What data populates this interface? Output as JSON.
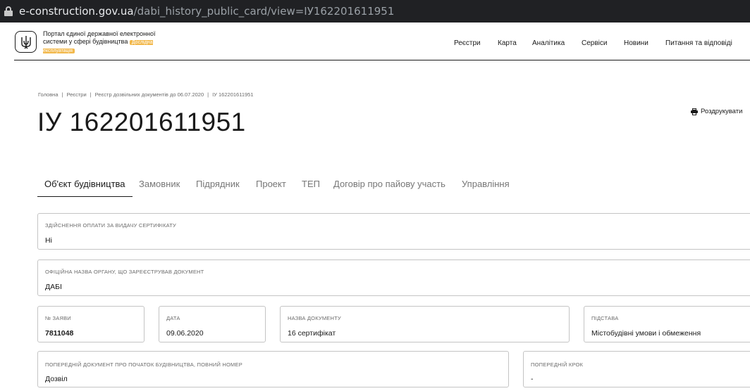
{
  "browser": {
    "url_domain": "e-construction.gov.ua",
    "url_path": "/dabi_history_public_card/view=ІУ162201611951"
  },
  "header": {
    "portal_name": "Портал єдиної державної електронної системи у сфері будівництва",
    "badge": "Дослідна експлуатація",
    "nav": [
      "Реєстри",
      "Карта",
      "Аналітика",
      "Сервіси",
      "Новини",
      "Питання та відповіді"
    ]
  },
  "breadcrumb": [
    "Головна",
    "Реєстри",
    "Реєстр дозвільних документів до 06.07.2020",
    "ІУ 162201611951"
  ],
  "title": "ІУ 162201611951",
  "print_label": "Роздрукувати",
  "tabs": [
    "Об'єкт будівництва",
    "Замовник",
    "Підрядник",
    "Проект",
    "ТЕП",
    "Договір про пайову участь",
    "Управління"
  ],
  "fields": {
    "payment": {
      "label": "Здійснення оплати за видачу сертифікату",
      "value": "Ні"
    },
    "authority": {
      "label": "Офіційна назва органу, що зареєстрував документ",
      "value": "ДАБІ"
    },
    "application_no": {
      "label": "№ заяви",
      "value": "7811048"
    },
    "date": {
      "label": "Дата",
      "value": "09.06.2020"
    },
    "doc_name": {
      "label": "Назва документу",
      "value": "16 сертифікат"
    },
    "basis": {
      "label": "Підстава",
      "value": "Містобудівні умови і обмеження"
    },
    "prev_doc": {
      "label": "Попередній документ про початок будівництва, повний номер",
      "value": "Дозвіл"
    },
    "prev_step": {
      "label": "Попередній крок",
      "value": "-"
    }
  },
  "colors": {
    "accent_badge": "#f2b84b",
    "border": "#c4c4c4",
    "text": "#1a1a1a",
    "muted": "#6b6b6b"
  }
}
